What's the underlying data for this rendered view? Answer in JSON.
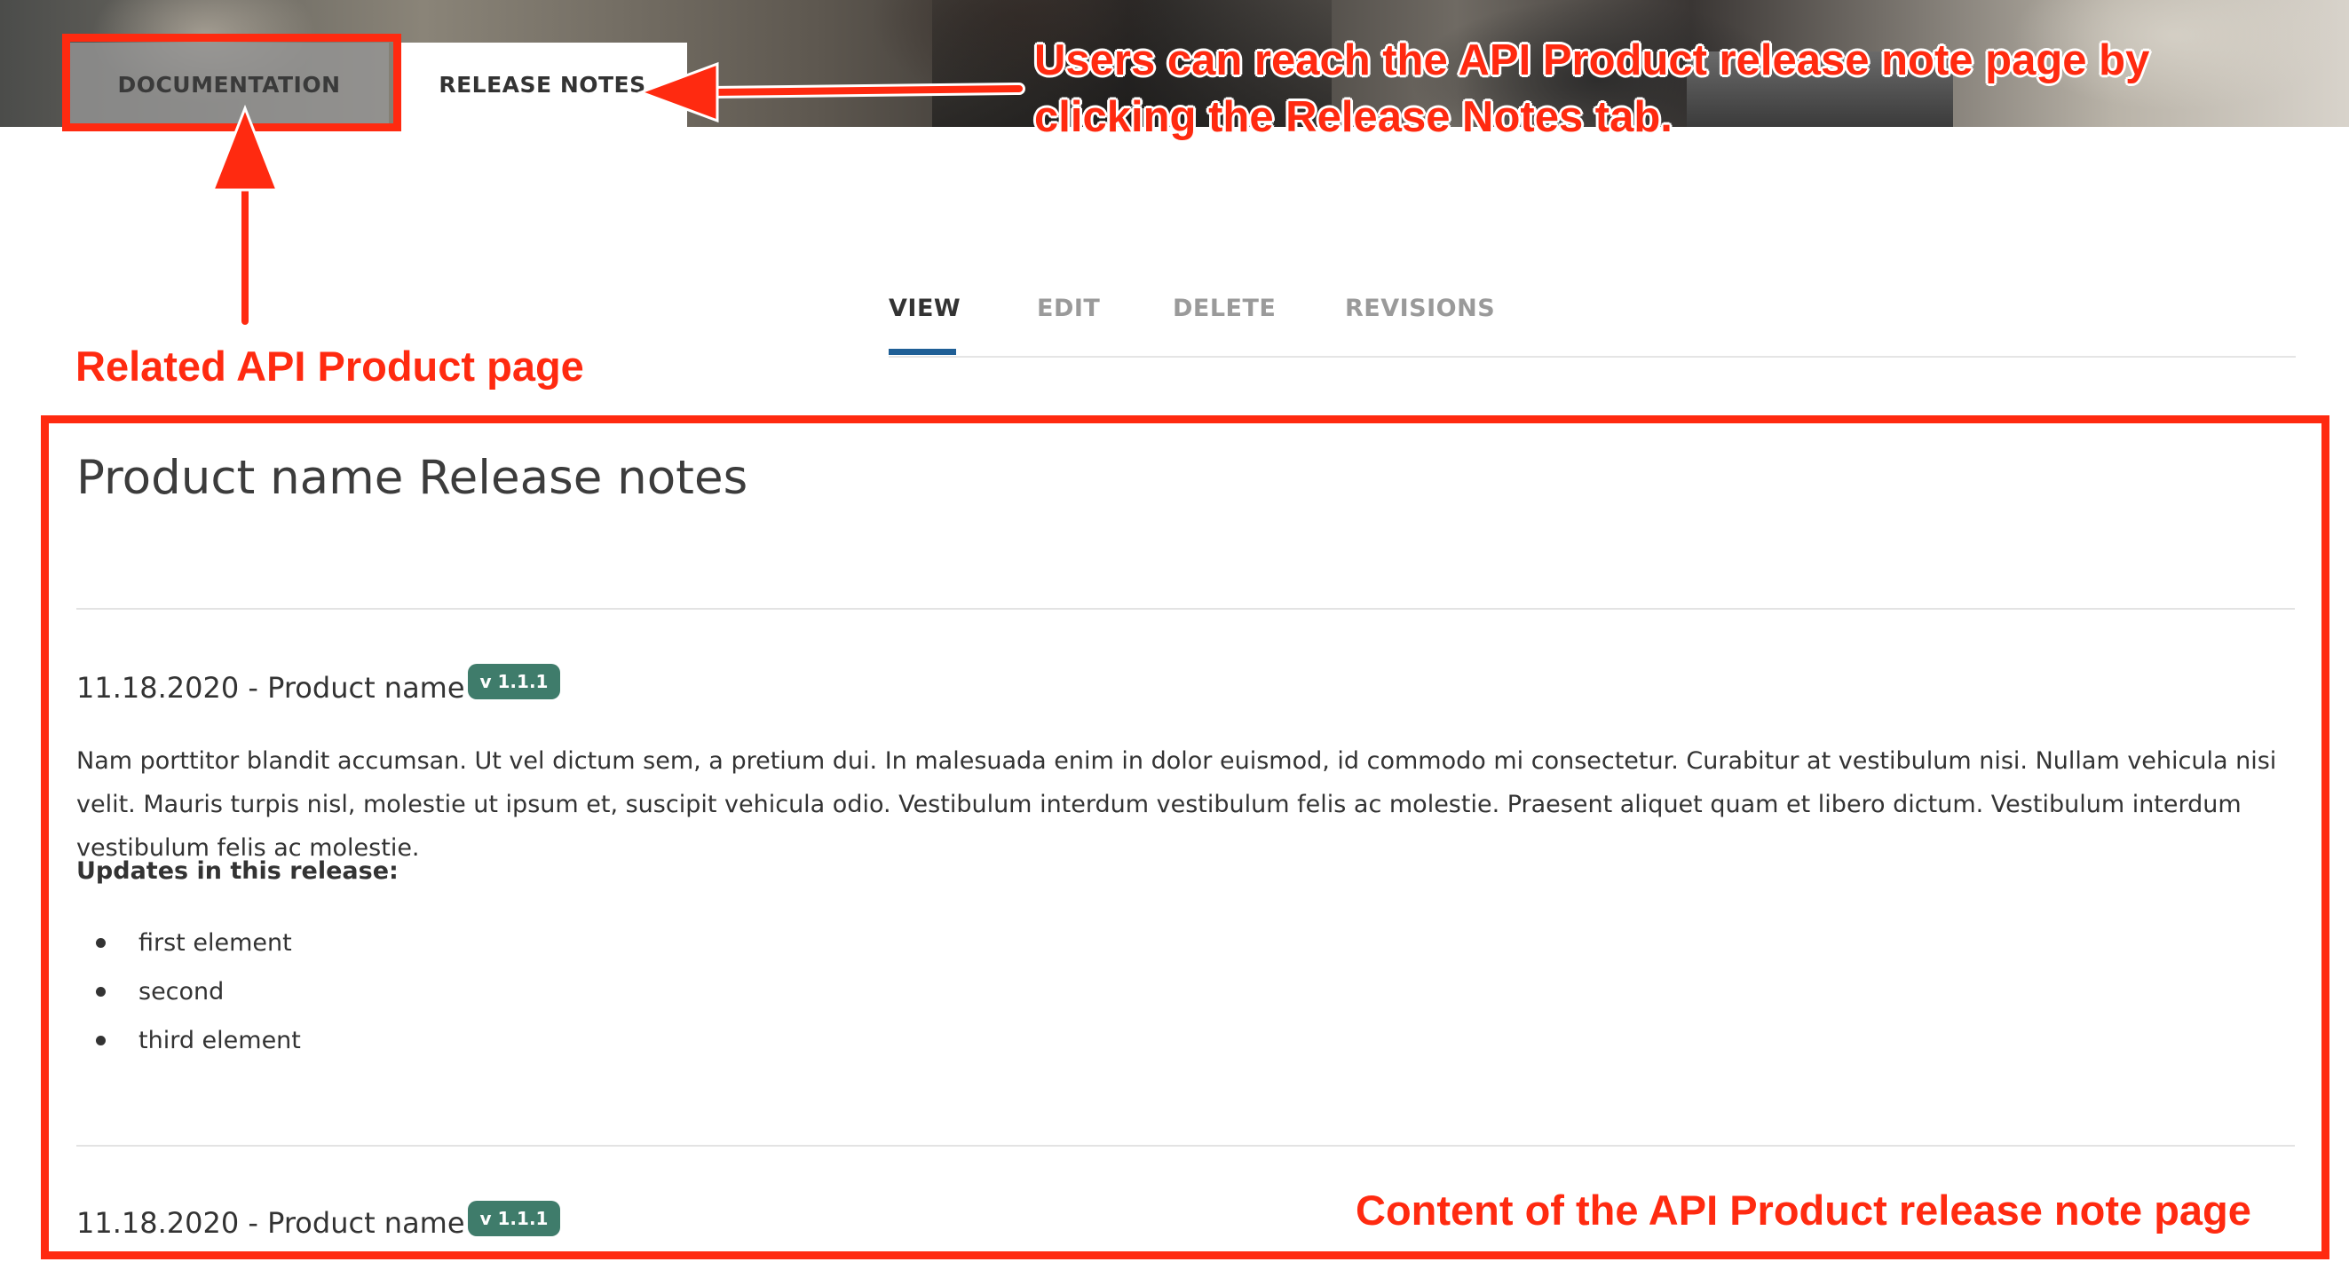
{
  "top_tabs": {
    "documentation": "DOCUMENTATION",
    "release_notes": "RELEASE NOTES"
  },
  "subtabs": {
    "view": "VIEW",
    "edit": "EDIT",
    "delete": "DELETE",
    "revisions": "REVISIONS"
  },
  "content": {
    "title": "Product name Release notes",
    "entries": [
      {
        "title": "11.18.2020 - Product name",
        "version": "v 1.1.1",
        "body": "Nam porttitor blandit accumsan. Ut vel dictum sem, a pretium dui. In malesuada enim in dolor euismod, id commodo mi consectetur. Curabitur at vestibulum nisi. Nullam vehicula nisi velit. Mauris turpis nisl, molestie ut ipsum et, suscipit vehicula odio. Vestibulum interdum vestibulum felis ac molestie. Praesent aliquet quam et libero dictum. Vestibulum interdum vestibulum felis ac molestie.",
        "updates_heading": "Updates in this release:",
        "updates": [
          "first element",
          "second",
          "third element"
        ]
      },
      {
        "title": "11.18.2020 - Product name",
        "version": "v 1.1.1"
      }
    ]
  },
  "annotations": {
    "tab_note_line1": "Users can reach the API Product release note page by",
    "tab_note_line2": "clicking the Release Notes tab.",
    "related_note": "Related API Product page",
    "content_note": "Content of the API Product release note page"
  },
  "colors": {
    "annotation": "#ff2a10",
    "badge": "#3f7c6b",
    "active_tab_underline": "#1f5f96"
  }
}
